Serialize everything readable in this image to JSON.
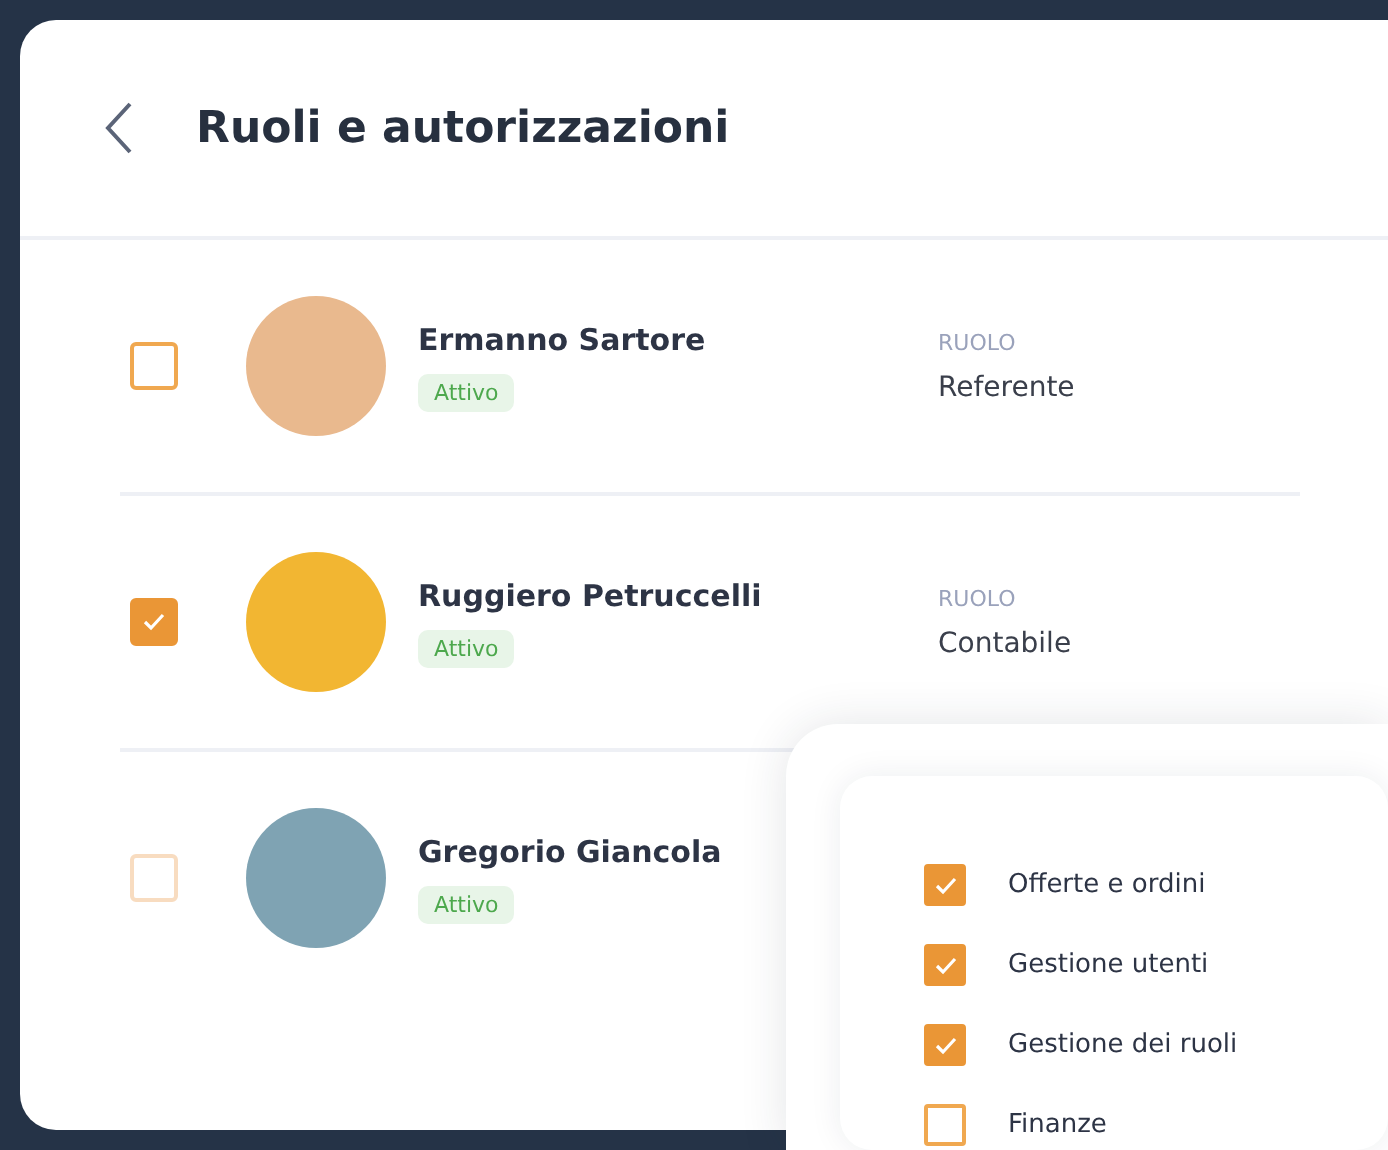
{
  "header": {
    "title": "Ruoli e autorizzazioni"
  },
  "users": [
    {
      "name": "Ermanno Sartore",
      "status": "Attivo",
      "role_label": "RUOLO",
      "role": "Referente",
      "checked": false,
      "disabled": false,
      "color": "#e9b98e"
    },
    {
      "name": "Ruggiero Petruccelli",
      "status": "Attivo",
      "role_label": "RUOLO",
      "role": "Contabile",
      "checked": true,
      "disabled": false,
      "color": "#f2b632"
    },
    {
      "name": "Gregorio Giancola",
      "status": "Attivo",
      "checked": false,
      "disabled": true,
      "color": "#7fa3b3"
    }
  ],
  "permissions": [
    {
      "label": "Offerte e ordini",
      "checked": true
    },
    {
      "label": "Gestione utenti",
      "checked": true
    },
    {
      "label": "Gestione dei ruoli",
      "checked": true
    },
    {
      "label": "Finanze",
      "checked": false
    }
  ]
}
